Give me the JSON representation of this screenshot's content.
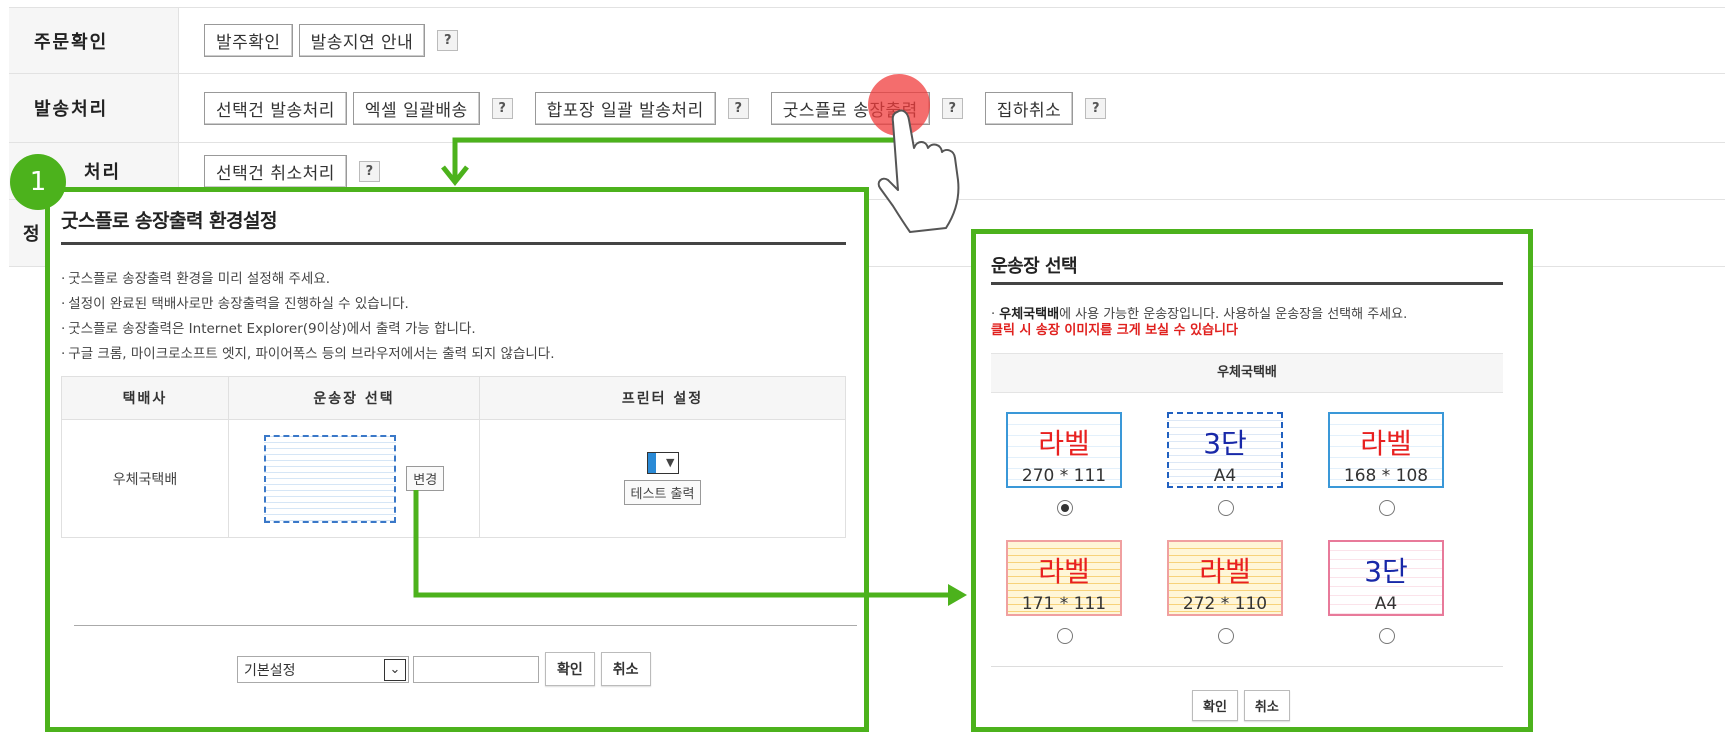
{
  "rows": [
    {
      "head": "주문확인",
      "buttons": [
        "발주확인",
        "발송지연 안내"
      ]
    },
    {
      "head": "발송처리",
      "buttons": [
        "선택건 발송처리",
        "엑셀 일괄배송",
        "합포장 일괄 발송처리",
        "굿스플로 송장출력",
        "집하취소"
      ]
    },
    {
      "head": "처리",
      "buttons": [
        "선택건 취소처리"
      ]
    },
    {
      "head": "정"
    }
  ],
  "help_glyph": "?",
  "step_number": "1",
  "setup_dialog": {
    "title": "굿스플로 송장출력 환경설정",
    "notes": [
      "굿스플로 송장출력 환경을 미리 설정해 주세요.",
      "설정이 완료된 택배사로만 송장출력을 진행하실 수 있습니다.",
      "굿스플로 송장출력은 Internet Explorer(9이상)에서 출력 가능 합니다.",
      "구글 크롬, 마이크로소프트 엣지, 파이어폭스 등의 브라우저에서는 출력 되지 않습니다."
    ],
    "columns": [
      "택배사",
      "운송장 선택",
      "프린터 설정"
    ],
    "carrier": "우체국택배",
    "change_button": "변경",
    "test_print_button": "테스트 출력",
    "preset_select": "기본설정",
    "confirm_button": "확인",
    "cancel_button": "취소"
  },
  "waybill_dialog": {
    "title": "운송장 선택",
    "notice_carrier": "우체국택배",
    "notice_text": "에 사용 가능한 운송장입니다. 사용하실 운송장을 선택해 주세요.",
    "notice_red": "클릭 시 송장 이미지를 크게 보실 수 있습니다",
    "carrier_header": "우체국택배",
    "labels": [
      {
        "type": "라벨",
        "size": "270 * 111",
        "selected": true,
        "color": "#e82020"
      },
      {
        "type": "3단",
        "size": "A4",
        "selected": false,
        "color": "#1828a8"
      },
      {
        "type": "라벨",
        "size": "168 * 108",
        "selected": false,
        "color": "#e82020"
      },
      {
        "type": "라벨",
        "size": "171 * 111",
        "selected": false,
        "color": "#e82020"
      },
      {
        "type": "라벨",
        "size": "272 * 110",
        "selected": false,
        "color": "#e82020"
      },
      {
        "type": "3단",
        "size": "A4",
        "selected": false,
        "color": "#1828a8"
      }
    ],
    "confirm_button": "확인",
    "cancel_button": "취소"
  },
  "colors": {
    "accent_green": "#4cb21c",
    "tap_red": "#f03c3c"
  }
}
